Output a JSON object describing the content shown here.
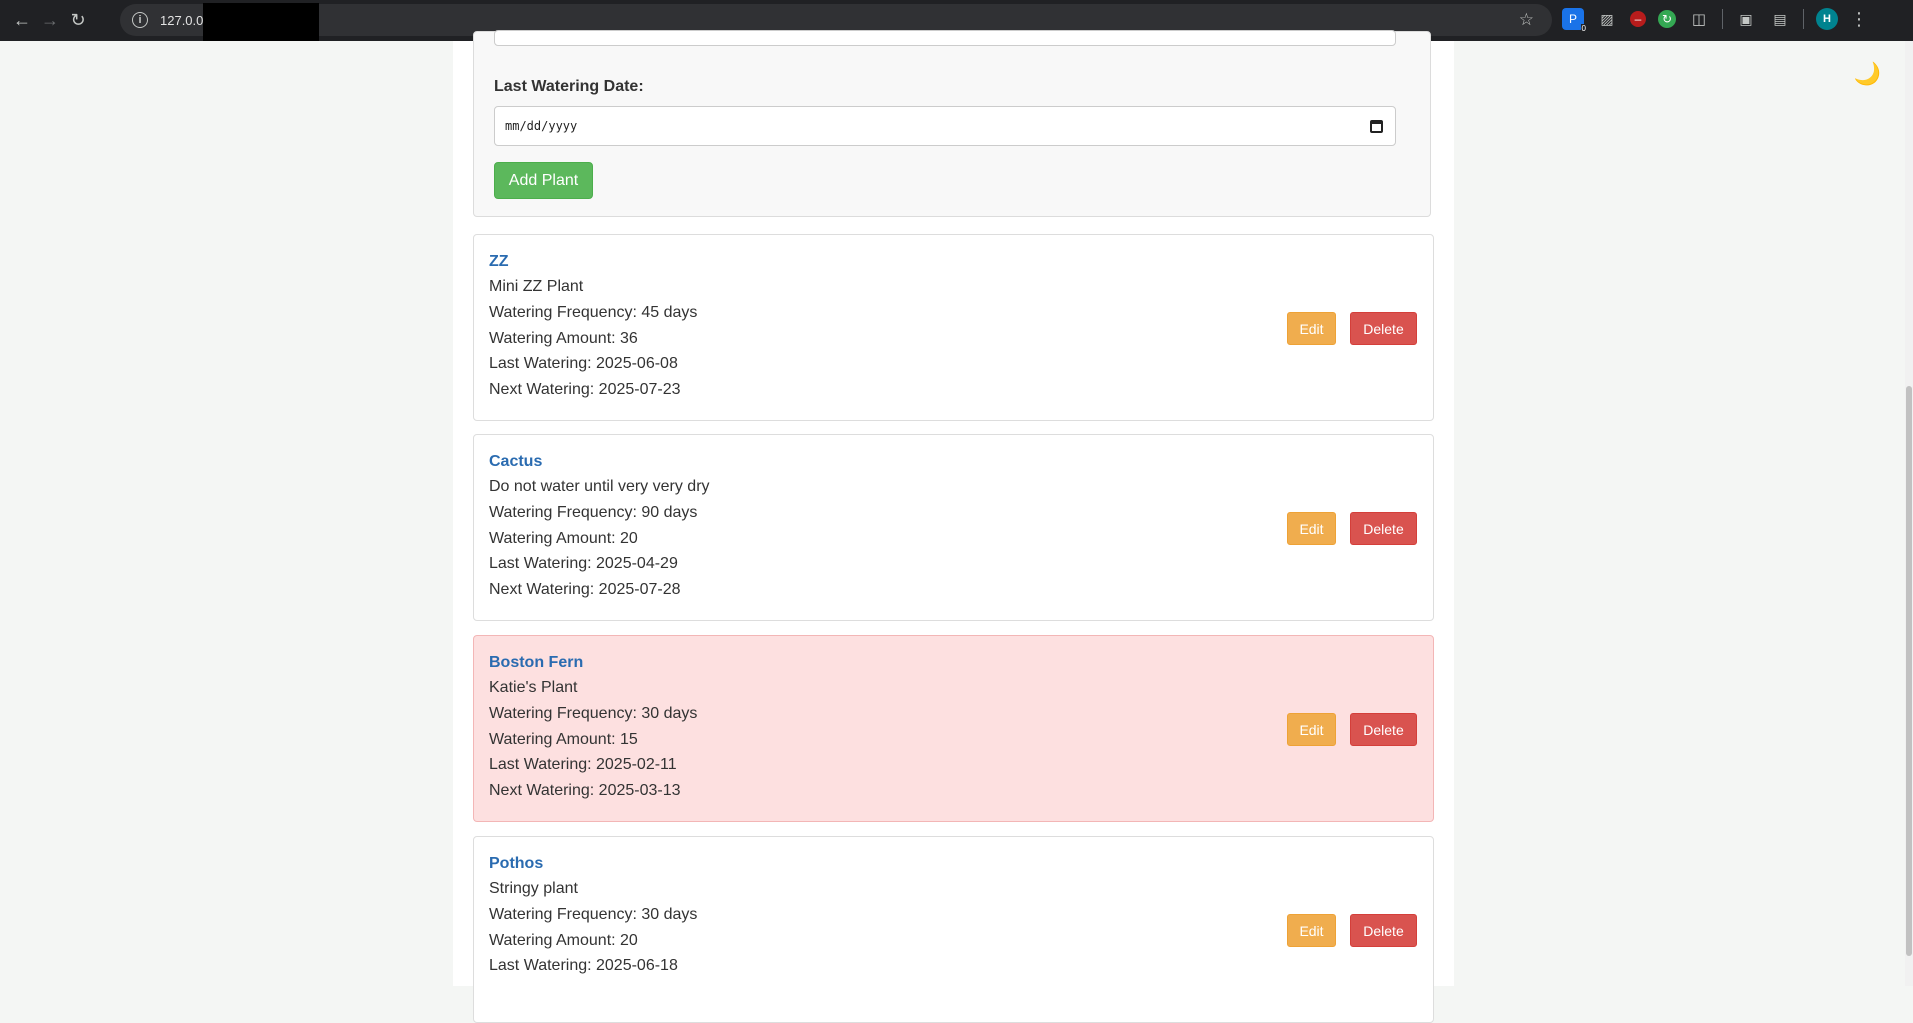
{
  "browser": {
    "url": "127.0.0.",
    "extensions": [
      "pin-extension",
      "image-extension",
      "blocker-extension",
      "refresh-extension",
      "puzzle-extension",
      "screenshot-extension",
      "search-tab-extension"
    ],
    "extension_badge": "0",
    "profile_initial": "H"
  },
  "page": {
    "theme_toggle": "🌙"
  },
  "form": {
    "last_watering_label": "Last Watering Date:",
    "date_placeholder": "mm/dd/yyyy",
    "add_button": "Add Plant"
  },
  "plants": [
    {
      "name": "ZZ",
      "notes": "Mini ZZ Plant",
      "frequency": "Watering Frequency: 45 days",
      "amount": "Watering Amount: 36",
      "last": "Last Watering: 2025-06-08",
      "next": "Next Watering: 2025-07-23",
      "overdue": false
    },
    {
      "name": "Cactus",
      "notes": "Do not water until very very dry",
      "frequency": "Watering Frequency: 90 days",
      "amount": "Watering Amount: 20",
      "last": "Last Watering: 2025-04-29",
      "next": "Next Watering: 2025-07-28",
      "overdue": false
    },
    {
      "name": "Boston Fern",
      "notes": "Katie's Plant",
      "frequency": "Watering Frequency: 30 days",
      "amount": "Watering Amount: 15",
      "last": "Last Watering: 2025-02-11",
      "next": "Next Watering: 2025-03-13",
      "overdue": true
    },
    {
      "name": "Pothos",
      "notes": "Stringy plant",
      "frequency": "Watering Frequency: 30 days",
      "amount": "Watering Amount: 20",
      "last": "Last Watering: 2025-06-18",
      "next": "",
      "overdue": false
    }
  ],
  "buttons": {
    "edit": "Edit",
    "delete": "Delete"
  },
  "colors": {
    "accent_link": "#2a6bb0",
    "add_green": "#5cb85c",
    "edit_orange": "#f0ad4e",
    "delete_red": "#d9534f",
    "overdue_bg": "#fde0e0"
  }
}
